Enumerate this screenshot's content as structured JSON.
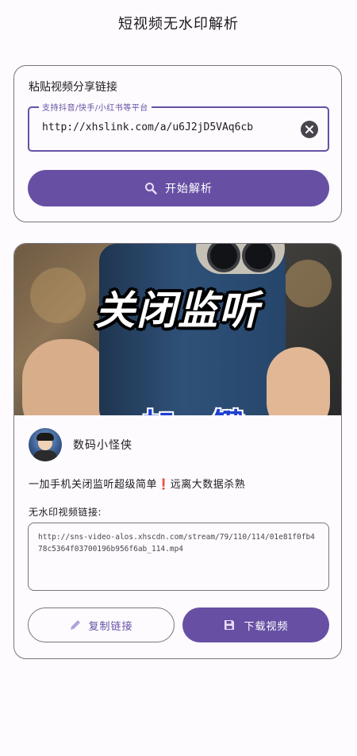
{
  "app": {
    "title": "短视频无水印解析"
  },
  "input_card": {
    "heading": "粘贴视频分享链接",
    "field_label": "支持抖音/快手/小红书等平台",
    "field_value": "http://xhslink.com/a/u6J2jD5VAq6cb",
    "parse_label": "开始解析"
  },
  "result": {
    "thumbnail": {
      "overlay_text": "关闭监听",
      "overlay_text_2": "一加一键"
    },
    "author_name": "数码小怪侠",
    "video_title": "一加手机关闭监听超级简单",
    "video_title_emoji": "❗",
    "video_title_tail": "远离大数据杀熟",
    "link_label": "无水印视频链接:",
    "video_link": "http://sns-video-alos.xhscdn.com/stream/79/110/114/01e81f0fb478c5364f03700196b956f6ab_114.mp4",
    "copy_label": "复制链接",
    "download_label": "下载视频"
  },
  "colors": {
    "primary": "#6750a4",
    "outline": "#79747e",
    "background": "#fdfbfe",
    "alert": "#e0312b"
  },
  "icons": [
    "close-circle-icon",
    "search-icon",
    "pencil-icon",
    "save-icon"
  ]
}
